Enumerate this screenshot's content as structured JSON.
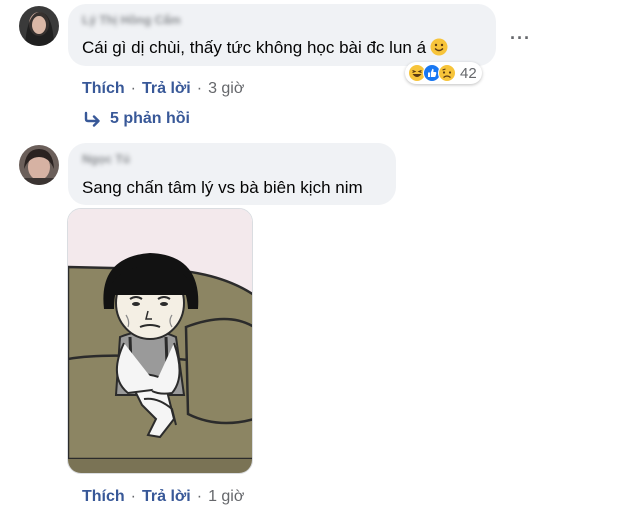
{
  "comments": [
    {
      "author": "Lý Thị Hồng Cẩm",
      "text": "Cái gì dị chùi, thấy tức không học bài đc lun á",
      "text_emoji_icon": "slightly-smiling-face-icon",
      "reactions": {
        "icons": [
          "laughing-icon",
          "like-icon",
          "sad-icon"
        ],
        "count": "42"
      },
      "actions": {
        "like": "Thích",
        "reply": "Trả lời",
        "time": "3 giờ"
      },
      "replies_label": "5 phản hồi"
    },
    {
      "author": "Ngọc Tú",
      "text": "Sang chấn tâm lý vs bà biên kịch nim",
      "sticker": "meme-boy-on-couch",
      "actions": {
        "like": "Thích",
        "reply": "Trả lời",
        "time": "1 giờ"
      }
    }
  ],
  "colors": {
    "bubble": "#f0f2f5",
    "link": "#385898",
    "muted": "#65676b",
    "like_blue": "#1877f2"
  }
}
